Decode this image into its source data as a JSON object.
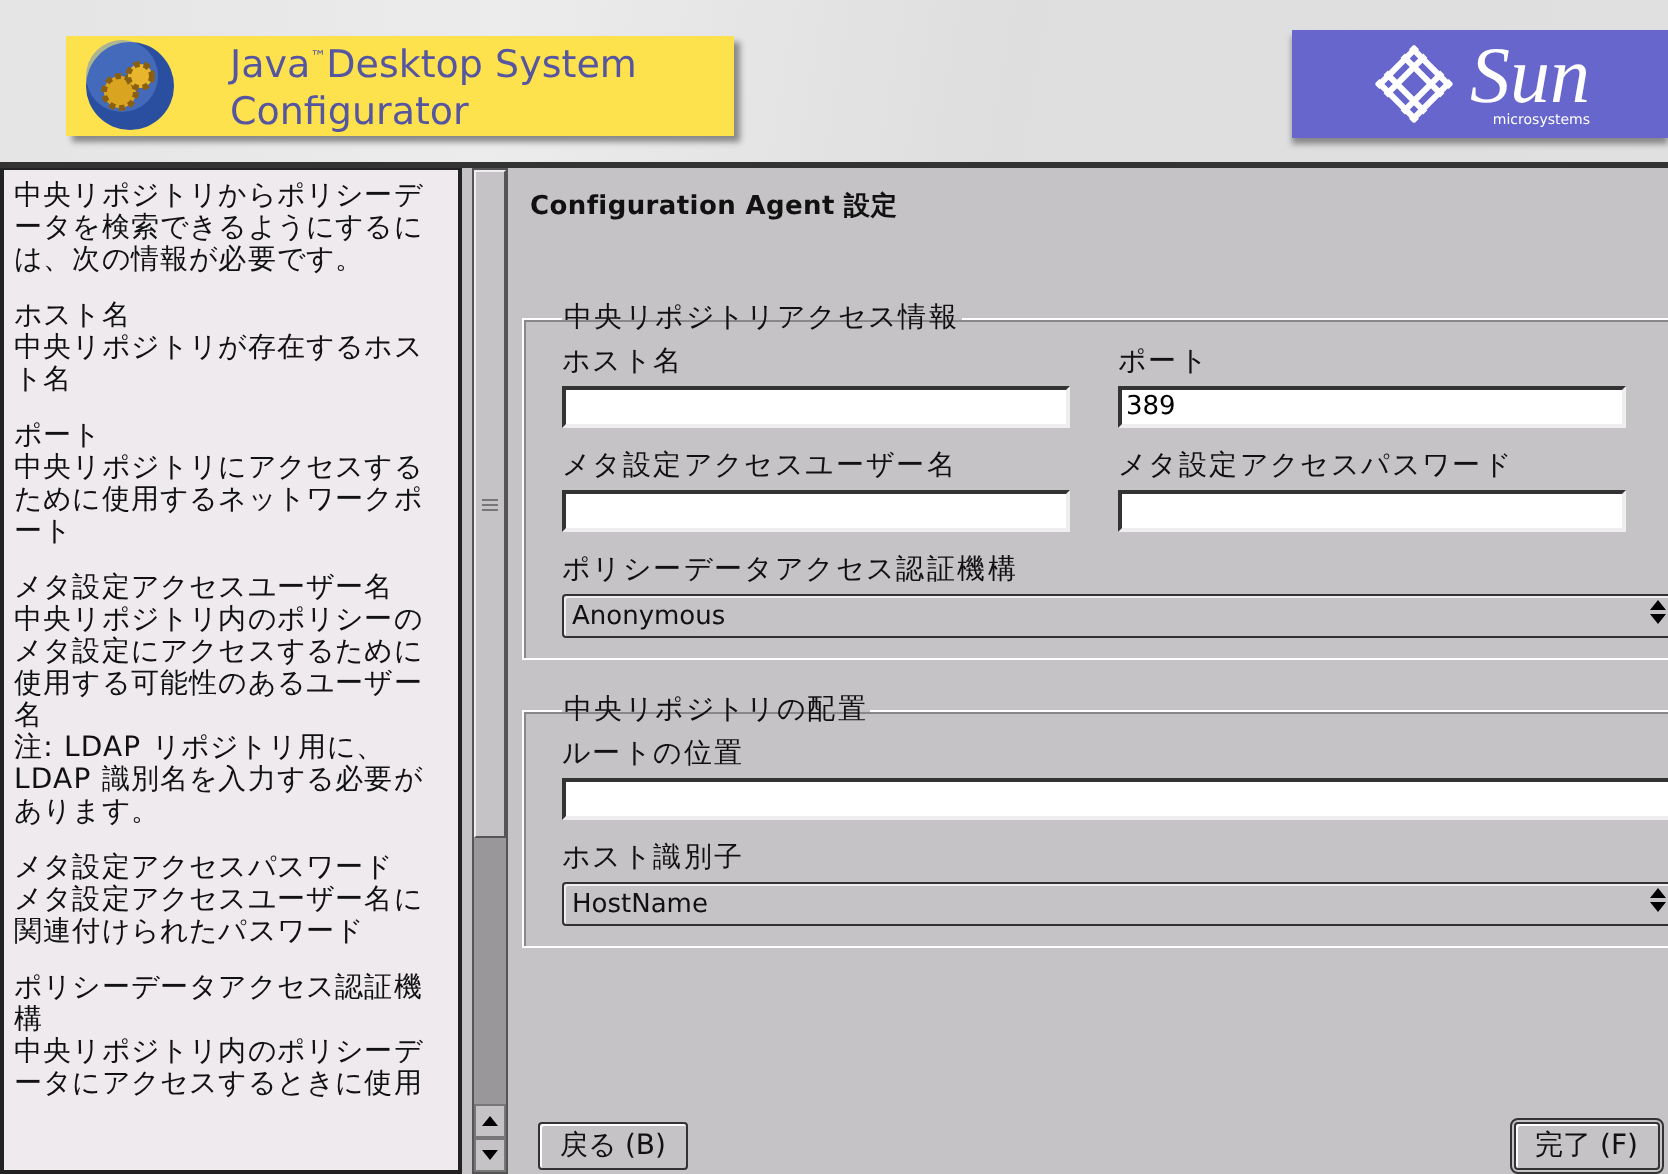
{
  "header": {
    "product_title": [
      "Java$^{™}$Desktop System",
      "Configurator"
    ],
    "vendor_logo": {
      "name": "Sun",
      "subtitle": "microsystems"
    }
  },
  "help": {
    "intro": "中央リポジトリからポリシーデータを検索できるようにするには、次の情報が必要です。",
    "sections": [
      {
        "title": "ホスト名",
        "lines": [
          "中央リポジトリが存在するホスト名"
        ]
      },
      {
        "title": "ポート",
        "lines": [
          "中央リポジトリにアクセスするために使用するネットワークポート"
        ]
      },
      {
        "title": "メタ設定アクセスユーザー名",
        "lines": [
          "中央リポジトリ内のポリシーのメタ設定にアクセスするために使用する可能性のあるユーザー名",
          "注: LDAP リポジトリ用に、LDAP 識別名を入力する必要があります。"
        ]
      },
      {
        "title": "メタ設定アクセスパスワード",
        "lines": [
          "メタ設定アクセスユーザー名に関連付けられたパスワード"
        ]
      },
      {
        "title": "ポリシーデータアクセス認証機構",
        "lines": [
          "中央リポジトリ内のポリシーデータにアクセスするときに使用"
        ]
      }
    ]
  },
  "page_title": "Configuration Agent 設定",
  "groups": [
    {
      "title": "中央リポジトリアクセス情報",
      "fields": [
        {
          "kind": "text",
          "label": "ホスト名",
          "half": true
        },
        {
          "kind": "text",
          "label": "ポート",
          "value": "389",
          "half": true
        },
        {
          "kind": "text",
          "label": "メタ設定アクセスユーザー名",
          "half": true
        },
        {
          "kind": "text",
          "label": "メタ設定アクセスパスワード",
          "half": true
        },
        {
          "kind": "select",
          "label": "ポリシーデータアクセス認証機構",
          "value": "Anonymous",
          "half": false
        }
      ]
    },
    {
      "title": "中央リポジトリの配置",
      "fields": [
        {
          "kind": "text",
          "label": "ルートの位置",
          "half": false
        },
        {
          "kind": "select",
          "label": "ホスト識別子",
          "value": "HostName",
          "half": false
        }
      ]
    }
  ],
  "buttons": [
    {
      "label": "戻る (B)",
      "default": false
    },
    {
      "label": "完了 (F)",
      "default": true
    }
  ]
}
